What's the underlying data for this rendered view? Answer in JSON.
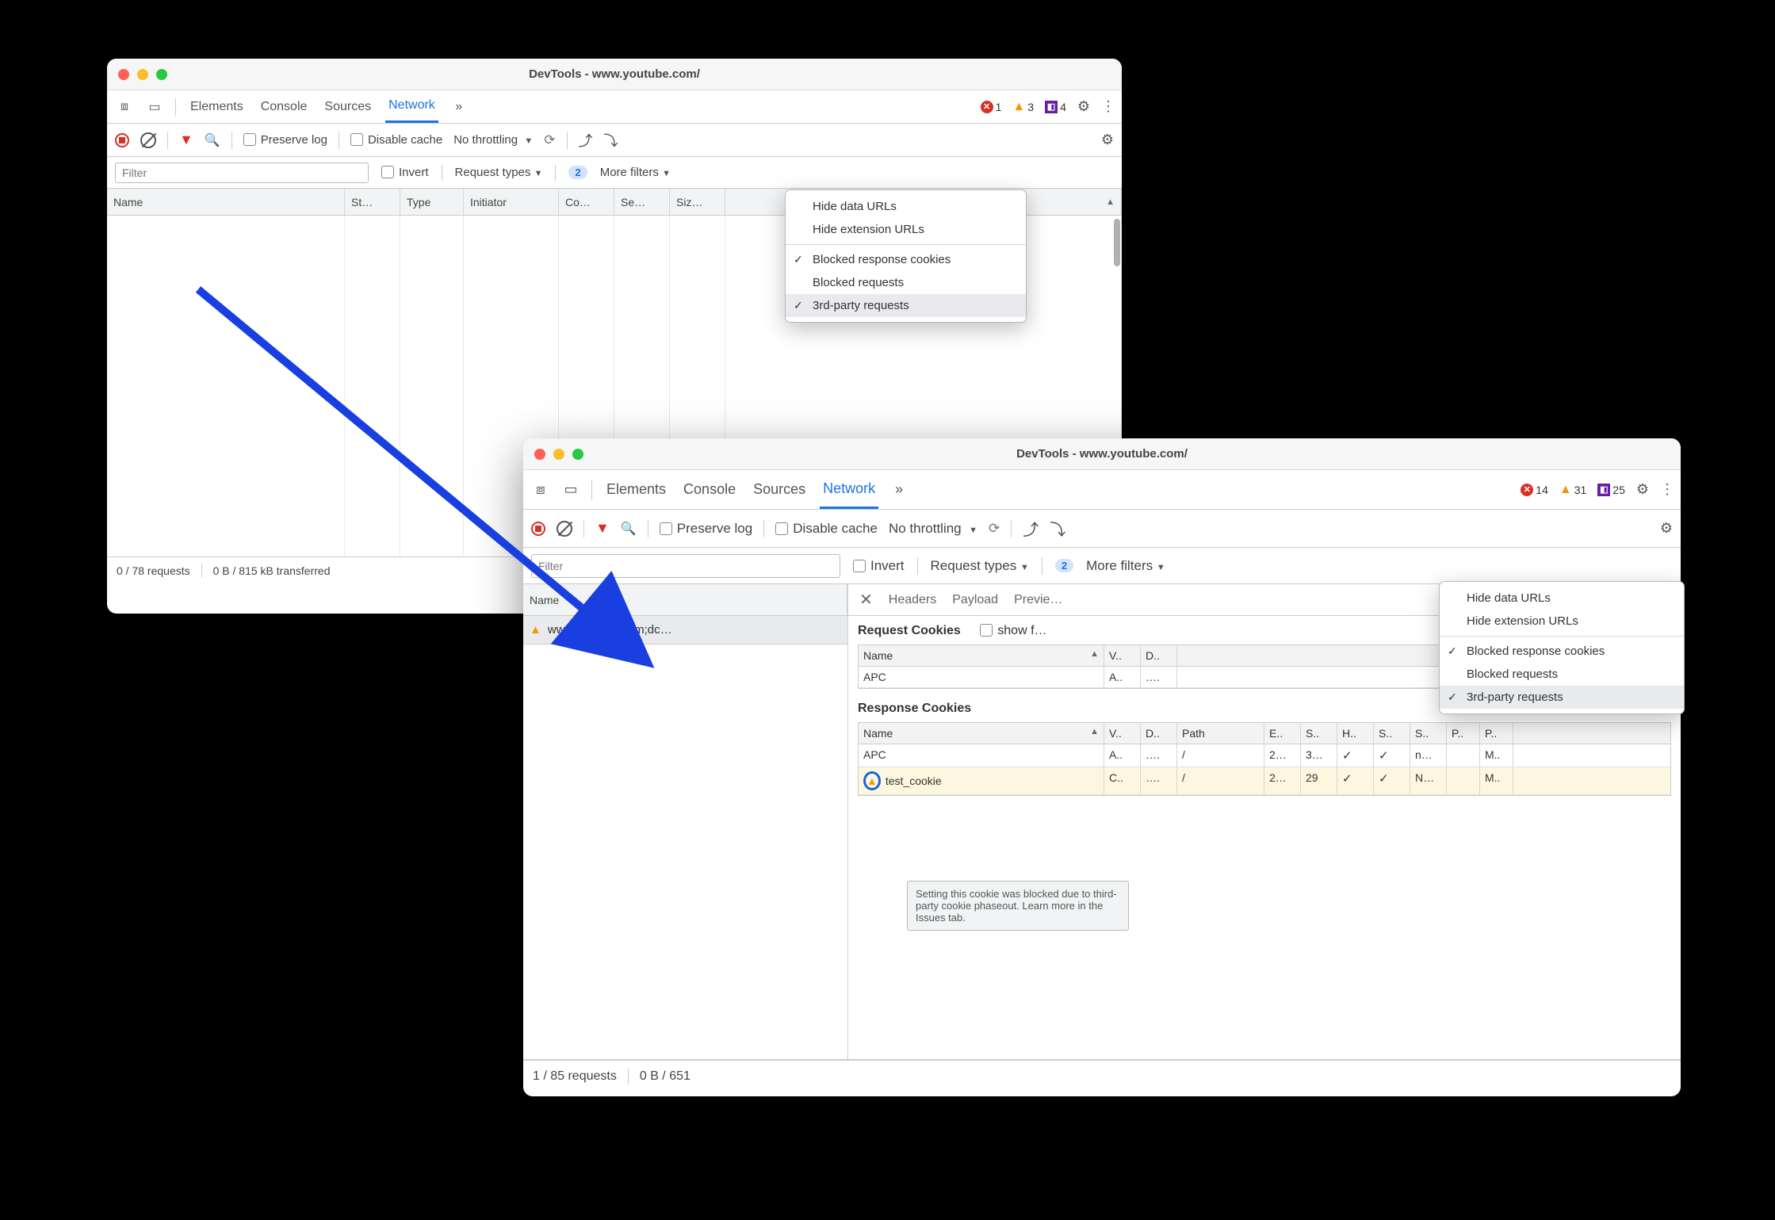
{
  "window1": {
    "title": "DevTools - www.youtube.com/",
    "tabs": {
      "elements": "Elements",
      "console": "Console",
      "sources": "Sources",
      "network": "Network"
    },
    "counts": {
      "errors": "1",
      "warnings": "3",
      "issues": "4"
    },
    "toolbar": {
      "preserve_log": "Preserve log",
      "disable_cache": "Disable cache",
      "throttle": "No throttling"
    },
    "filterbar": {
      "placeholder": "Filter",
      "invert": "Invert",
      "request_types": "Request types",
      "more_filters": "More filters",
      "more_count": "2"
    },
    "columns": {
      "name": "Name",
      "status": "St…",
      "type": "Type",
      "initiator": "Initiator",
      "co": "Co…",
      "se": "Se…",
      "size": "Siz…"
    },
    "menu": {
      "hide_data": "Hide data URLs",
      "hide_ext": "Hide extension URLs",
      "blocked_cookies": "Blocked response cookies",
      "blocked_req": "Blocked requests",
      "third_party": "3rd-party requests"
    },
    "status": {
      "requests": "0 / 78 requests",
      "transfer": "0 B / 815 kB transferred"
    }
  },
  "window2": {
    "title": "DevTools - www.youtube.com/",
    "tabs": {
      "elements": "Elements",
      "console": "Console",
      "sources": "Sources",
      "network": "Network"
    },
    "counts": {
      "errors": "14",
      "warnings": "31",
      "issues": "25"
    },
    "toolbar": {
      "preserve_log": "Preserve log",
      "disable_cache": "Disable cache",
      "throttle": "No throttling"
    },
    "filterbar": {
      "placeholder": "Filter",
      "invert": "Invert",
      "request_types": "Request types",
      "more_filters": "More filters",
      "more_count": "2"
    },
    "namecol": "Name",
    "request_row": "www.youtube.com;dc…",
    "detail_tabs": {
      "headers": "Headers",
      "payload": "Payload",
      "preview": "Previe…"
    },
    "req_cookies_title": "Request Cookies",
    "show_filtered": "show f…",
    "resp_cookies_title": "Response Cookies",
    "cookie_cols": {
      "name": "Name",
      "v": "V..",
      "d": "D..",
      "path": "Path",
      "e": "E..",
      "s": "S..",
      "h": "H..",
      "s2": "S..",
      "s3": "S..",
      "p": "P..",
      "p2": "P.."
    },
    "req_cookies": [
      {
        "name": "APC",
        "v": "A..",
        "d": "…."
      }
    ],
    "resp_cookies": [
      {
        "name": "APC",
        "v": "A..",
        "d": "….",
        "path": "/",
        "e": "2…",
        "s": "3…",
        "h": "✓",
        "h2": "✓",
        "s2": "n…",
        "p": "",
        "p2": "M.."
      },
      {
        "name": "test_cookie",
        "v": "C..",
        "d": "….",
        "path": "/",
        "e": "2…",
        "s": "29",
        "h": "✓",
        "h2": "✓",
        "s2": "N…",
        "p": "",
        "p2": "M.."
      }
    ],
    "menu": {
      "hide_data": "Hide data URLs",
      "hide_ext": "Hide extension URLs",
      "blocked_cookies": "Blocked response cookies",
      "blocked_req": "Blocked requests",
      "third_party": "3rd-party requests"
    },
    "tooltip": "Setting this cookie was blocked due to third-party cookie phaseout. Learn more in the Issues tab.",
    "status": {
      "requests": "1 / 85 requests",
      "transfer": "0 B / 651"
    }
  }
}
